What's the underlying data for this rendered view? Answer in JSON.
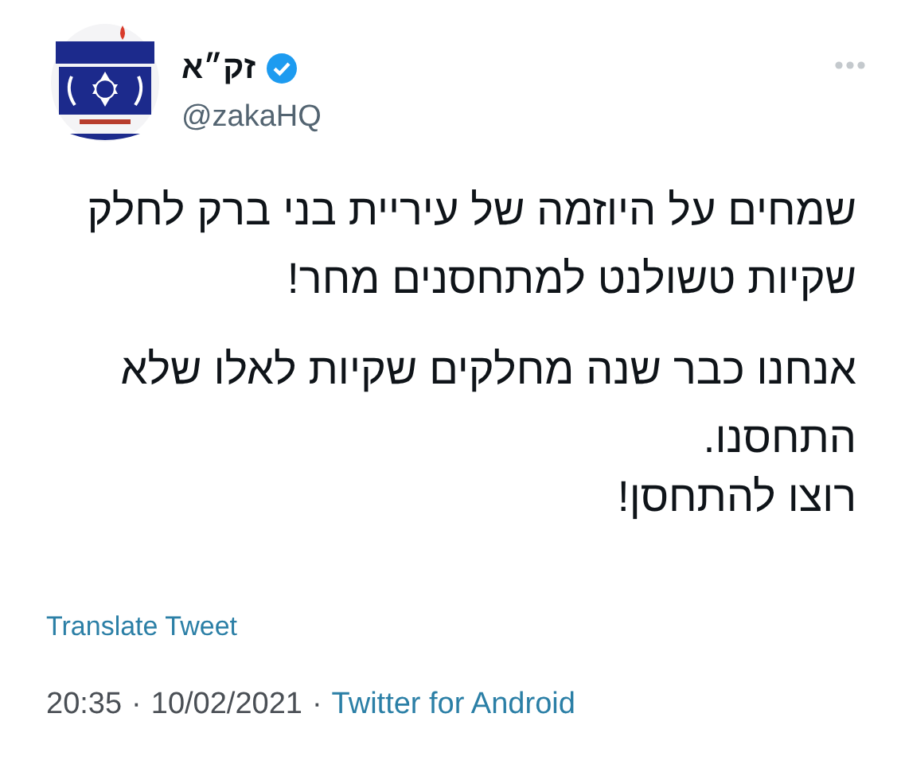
{
  "author": {
    "name": "זק״א",
    "verified": true,
    "handle": "@zakaHQ"
  },
  "tweet": {
    "lines": [
      "שמחים על היוזמה של עיריית בני ברק לחלק",
      "שקיות טשולנט למתחסנים מחר!",
      "אנחנו כבר שנה מחלקים שקיות לאלו שלא",
      "התחסנו.",
      "רוצו להתחסן!"
    ]
  },
  "translate_link": "Translate Tweet",
  "meta": {
    "time": "20:35",
    "separator": "·",
    "date": "10/02/2021",
    "source": "Twitter for Android"
  }
}
